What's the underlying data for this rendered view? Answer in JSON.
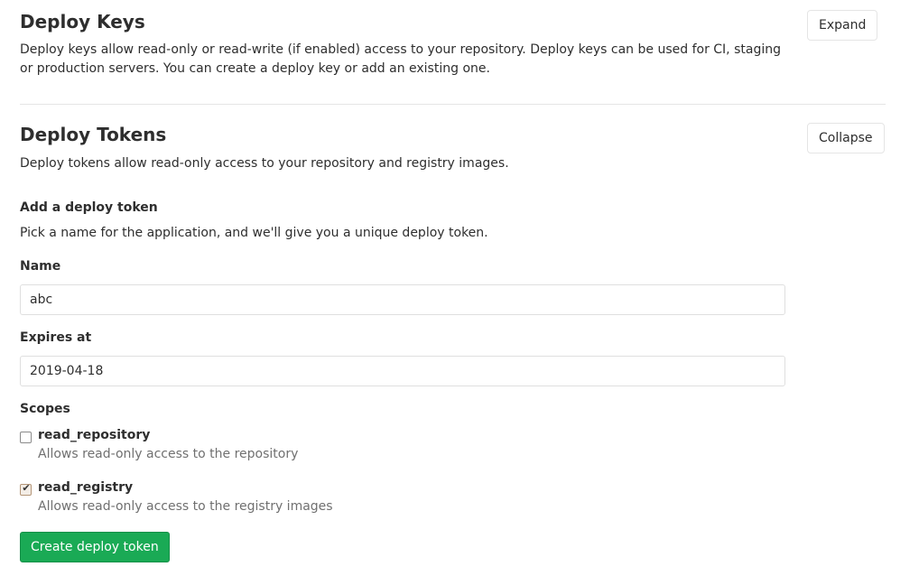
{
  "deploy_keys": {
    "title": "Deploy Keys",
    "description": "Deploy keys allow read-only or read-write (if enabled) access to your repository. Deploy keys can be used for CI, staging or production servers. You can create a deploy key or add an existing one.",
    "toggle_label": "Expand"
  },
  "deploy_tokens": {
    "title": "Deploy Tokens",
    "description": "Deploy tokens allow read-only access to your repository and registry images.",
    "toggle_label": "Collapse",
    "form": {
      "heading": "Add a deploy token",
      "subheading": "Pick a name for the application, and we'll give you a unique deploy token.",
      "name_label": "Name",
      "name_value": "abc",
      "expires_label": "Expires at",
      "expires_value": "2019-04-18",
      "scopes_label": "Scopes",
      "scopes": [
        {
          "name": "read_repository",
          "help": "Allows read-only access to the repository",
          "checked": false
        },
        {
          "name": "read_registry",
          "help": "Allows read-only access to the registry images",
          "checked": true
        }
      ],
      "submit_label": "Create deploy token"
    }
  },
  "colors": {
    "primary_green": "#1aaa55",
    "border": "#e5e5e5",
    "muted_text": "#707070"
  }
}
